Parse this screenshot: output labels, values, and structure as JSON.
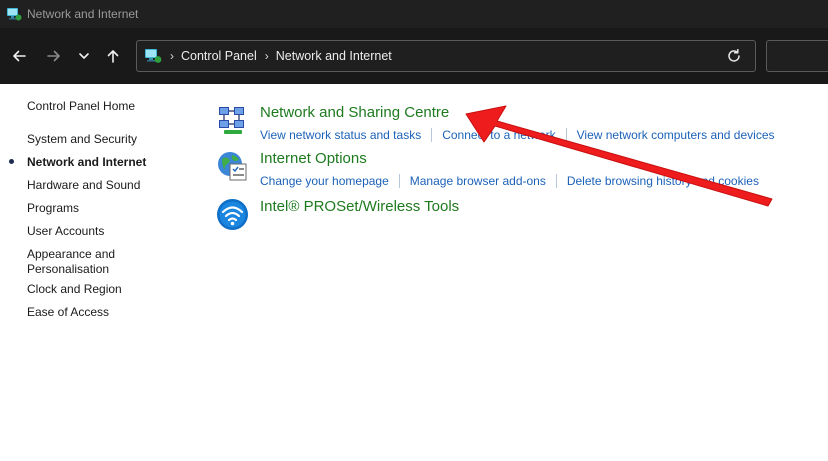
{
  "window": {
    "title": "Network and Internet"
  },
  "navigation": {
    "breadcrumbs": [
      "Control Panel",
      "Network and Internet"
    ]
  },
  "sidebar": {
    "items": [
      {
        "label": "Control Panel Home"
      },
      {
        "label": "System and Security"
      },
      {
        "label": "Network and Internet",
        "active": true
      },
      {
        "label": "Hardware and Sound"
      },
      {
        "label": "Programs"
      },
      {
        "label": "User Accounts"
      },
      {
        "label": "Appearance and Personalisation"
      },
      {
        "label": "Clock and Region"
      },
      {
        "label": "Ease of Access"
      }
    ]
  },
  "categories": [
    {
      "title": "Network and Sharing Centre",
      "icon": "network-sharing-icon",
      "links": [
        "View network status and tasks",
        "Connect to a network",
        "View network computers and devices"
      ]
    },
    {
      "title": "Internet Options",
      "icon": "internet-options-icon",
      "links": [
        "Change your homepage",
        "Manage browser add-ons",
        "Delete browsing history and cookies"
      ]
    },
    {
      "title": "Intel® PROSet/Wireless Tools",
      "icon": "wireless-icon",
      "links": []
    }
  ],
  "colors": {
    "titlebar_bg": "#202020",
    "navbar_bg": "#191919",
    "category_title": "#1e7a1e",
    "link": "#1c62b8",
    "annotation_arrow": "#ee1c1c"
  }
}
